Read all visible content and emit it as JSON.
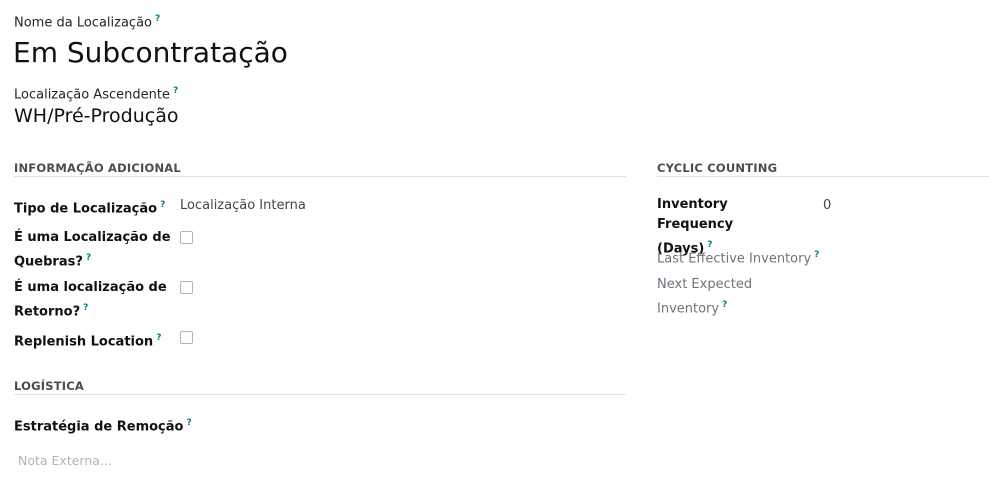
{
  "header": {
    "name_label": "Nome da Localização",
    "name_value": "Em Subcontratação",
    "parent_label": "Localização Ascendente",
    "parent_value": "WH/Pré-Produção",
    "tooltip_mark": "?"
  },
  "info_section": {
    "title": "INFORMAÇÃO ADICIONAL",
    "location_type_label": "Tipo de Localização",
    "location_type_value": "Localização Interna",
    "scrap_label_line1": "É uma Localização de",
    "scrap_label_line2": "Quebras?",
    "scrap_checked": false,
    "return_label_line1": "É uma localização de",
    "return_label_line2": "Retorno?",
    "return_checked": false,
    "replenish_label": "Replenish Location",
    "replenish_checked": false
  },
  "logistics_section": {
    "title": "LOGÍSTICA",
    "removal_label": "Estratégia de Remoção",
    "note_placeholder": "Nota Externa..."
  },
  "cyclic_section": {
    "title": "CYCLIC COUNTING",
    "frequency_label_line1": "Inventory Frequency",
    "frequency_label_line2": "(Days)",
    "frequency_value": "0",
    "last_inventory_label": "Last Effective Inventory",
    "next_inventory_label_line1": "Next Expected",
    "next_inventory_label_line2": "Inventory"
  }
}
